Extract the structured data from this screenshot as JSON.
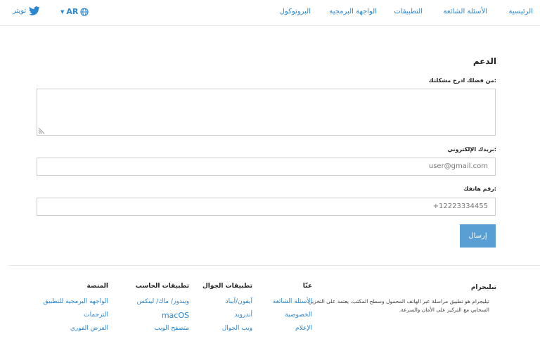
{
  "header": {
    "nav": [
      "الرئيسية",
      "الأسئلة الشائعة",
      "التطبيقات",
      "الواجهة البرمجية",
      "البروتوكول"
    ],
    "language": "AR",
    "twitter_label": "تويتر"
  },
  "form": {
    "title": "الدعم",
    "message_label": "من فضلك ادرج مشكلتك:",
    "message_value": "",
    "email_label": "بريدك الإلكتروني:",
    "email_placeholder": "user@gmail.com",
    "phone_label": "رقم هاتفك:",
    "phone_placeholder": "+12223334455",
    "submit_label": "إرسال"
  },
  "footer": {
    "about": {
      "heading": "تيليجرام",
      "text": "تيليجرام هو تطبيق مراسلة عبر الهاتف المحمول وسطح المكتب، يعتمد على التخزين السحابي مع التركيز على الأمان والسرعة."
    },
    "columns": [
      {
        "heading": "عنّا",
        "links": [
          "الأسئلة الشائعة",
          "الخصوصية",
          "الإعلام"
        ]
      },
      {
        "heading": "تطبيقات الجوال",
        "links": [
          "آيفون/آيباد",
          "أندرويد",
          "ويب الجوال"
        ]
      },
      {
        "heading": "تطبيقات الحاسب",
        "links": [
          "ويندوز/ ماك/ لينكس",
          "macOS",
          "متصفح الويب"
        ]
      },
      {
        "heading": "المنصة",
        "links": [
          "الواجهة البرمجية للتطبيق",
          "الترجمات",
          "العرض الفوري"
        ]
      }
    ]
  },
  "colors": {
    "link": "#2a86d0",
    "button": "#5a9fd4"
  }
}
